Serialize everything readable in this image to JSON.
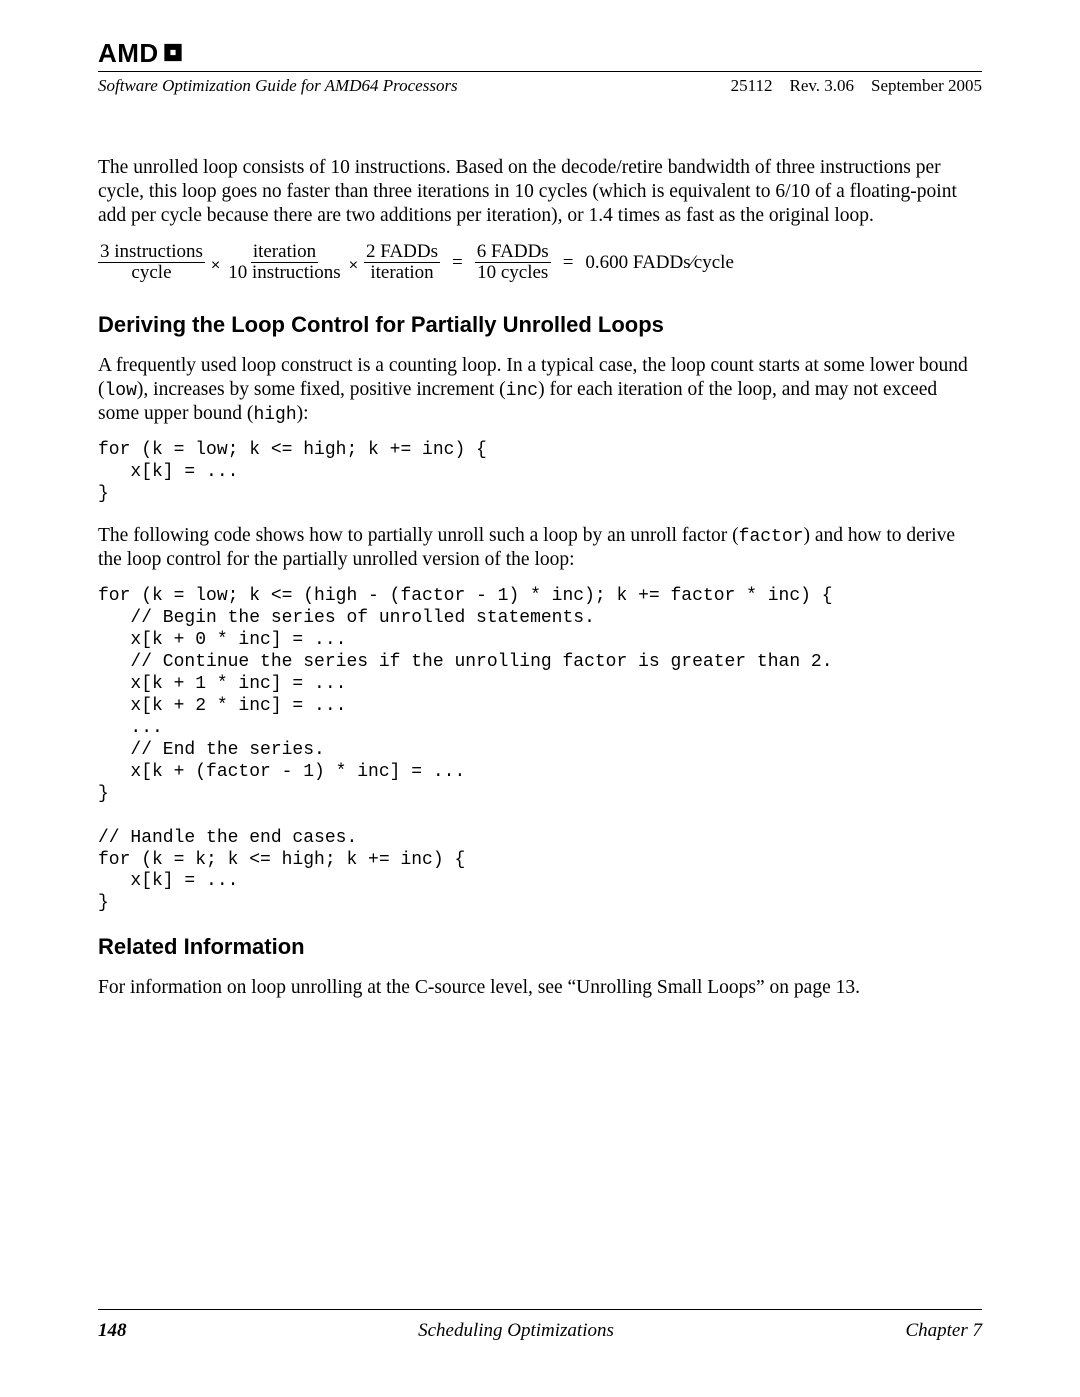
{
  "header": {
    "logo_text": "AMD",
    "doc_title": "Software Optimization Guide for AMD64 Processors",
    "doc_meta": "25112 Rev. 3.06 September 2005"
  },
  "para_intro": "The unrolled loop consists of 10 instructions. Based on the decode/retire bandwidth of three instructions per cycle, this loop goes no faster than three iterations in 10 cycles (which is equivalent to 6/10 of a floating-point add per cycle because there are two additions per iteration), or 1.4 times as fast as the original loop.",
  "equation": {
    "f1_num": "3 instructions",
    "f1_den": "cycle",
    "f2_num": "iteration",
    "f2_den": "10 instructions",
    "f3_num": "2 FADDs",
    "f3_den": "iteration",
    "f4_num": "6 FADDs",
    "f4_den": "10 cycles",
    "result": "0.600 FADDs⁄cycle"
  },
  "section1_title": "Deriving the Loop Control for Partially Unrolled Loops",
  "para_s1_a_pre": "A frequently used loop construct is a counting loop. In a typical case, the loop count starts at some lower bound (",
  "mono_low": "low",
  "para_s1_a_mid1": "), increases by some fixed, positive increment (",
  "mono_inc": "inc",
  "para_s1_a_mid2": ") for each iteration of the loop, and may not exceed some upper bound (",
  "mono_high": "high",
  "para_s1_a_post": "):",
  "code1": "for (k = low; k <= high; k += inc) {\n   x[k] = ...\n}",
  "para_s1_b_pre": "The following code shows how to partially unroll such a loop by an unroll factor (",
  "mono_factor": "factor",
  "para_s1_b_post": ") and how to derive the loop control for the partially unrolled version of the loop:",
  "code2": "for (k = low; k <= (high - (factor - 1) * inc); k += factor * inc) {\n   // Begin the series of unrolled statements.\n   x[k + 0 * inc] = ...\n   // Continue the series if the unrolling factor is greater than 2.\n   x[k + 1 * inc] = ...\n   x[k + 2 * inc] = ...\n   ...\n   // End the series.\n   x[k + (factor - 1) * inc] = ...\n}\n\n// Handle the end cases.\nfor (k = k; k <= high; k += inc) {\n   x[k] = ...\n}",
  "section2_title": "Related Information",
  "para_s2": "For information on loop unrolling at the C-source level, see “Unrolling Small Loops” on page 13.",
  "footer": {
    "page_num": "148",
    "chapter_title": "Scheduling Optimizations",
    "chapter_label": "Chapter 7"
  }
}
